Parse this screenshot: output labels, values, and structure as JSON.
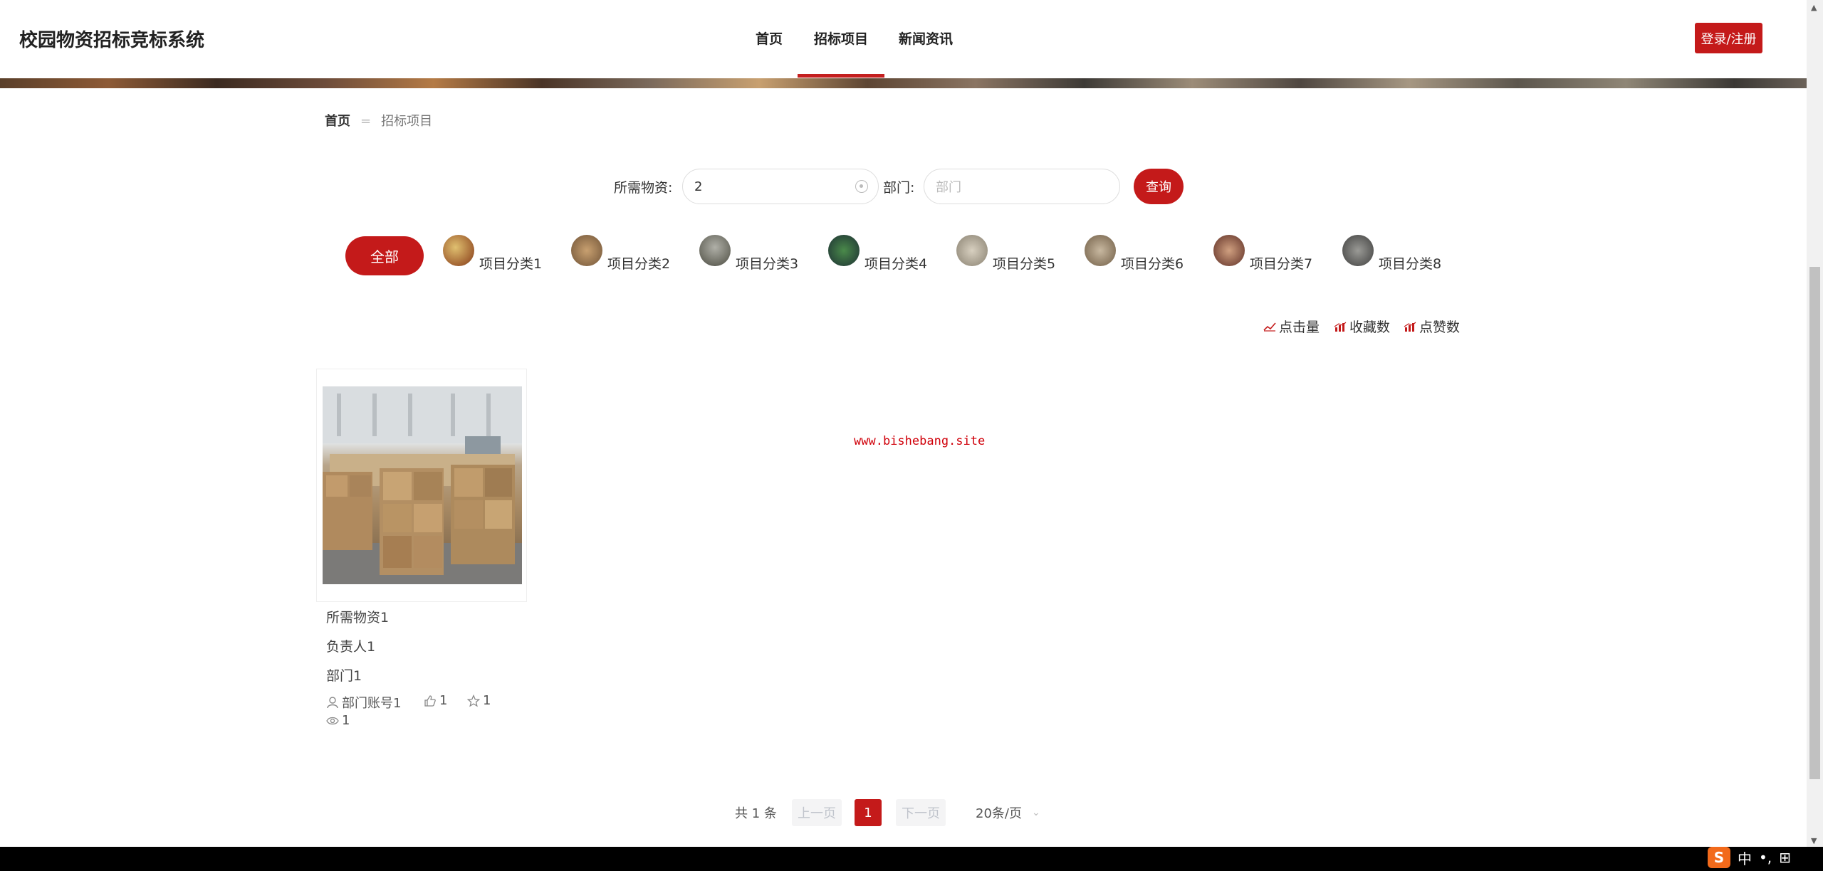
{
  "header": {
    "logo": "校园物资招标竞标系统",
    "nav": [
      "首页",
      "招标项目",
      "新闻资讯"
    ],
    "active_nav": "招标项目",
    "login_label": "登录/注册"
  },
  "breadcrumb": {
    "home": "首页",
    "separator": "=",
    "current": "招标项目"
  },
  "search": {
    "material_label": "所需物资:",
    "material_value": "2",
    "dept_label": "部门:",
    "dept_placeholder": "部门",
    "query_label": "查询"
  },
  "categories": {
    "all_label": "全部",
    "items": [
      "项目分类1",
      "项目分类2",
      "项目分类3",
      "项目分类4",
      "项目分类5",
      "项目分类6",
      "项目分类7",
      "项目分类8"
    ]
  },
  "sort": {
    "clicks": "点击量",
    "favorites": "收藏数",
    "likes": "点赞数"
  },
  "card": {
    "material": "所需物资1",
    "owner": "负责人1",
    "dept": "部门1",
    "account": "部门账号1",
    "likes": "1",
    "stars": "1",
    "views": "1"
  },
  "watermark": "www.bishebang.site",
  "pagination": {
    "total": "共 1 条",
    "prev": "上一页",
    "current": "1",
    "next": "下一页",
    "page_size": "20条/页"
  },
  "taskbar": {
    "ime_logo": "S",
    "ime_lang": "中",
    "ime_punct": "•,",
    "ime_mode": "⊞"
  },
  "colors": {
    "accent": "#c41a1a"
  }
}
